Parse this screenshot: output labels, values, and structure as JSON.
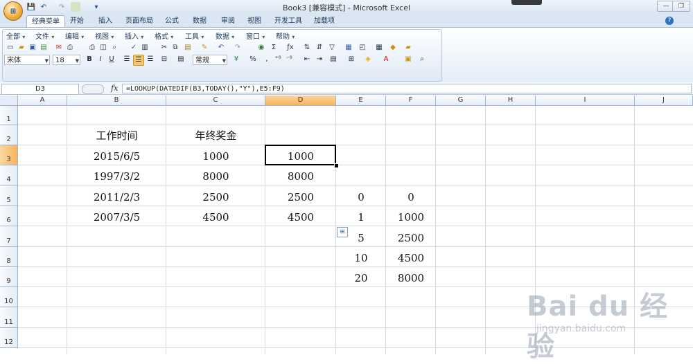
{
  "window": {
    "title": "Book3  [兼容模式] - Microsoft Excel",
    "office_button": "⊞",
    "controls": [
      "—",
      "❐",
      "✕"
    ]
  },
  "quick_access": [
    "💾",
    "↶",
    "↷",
    "▾"
  ],
  "ribbon": {
    "tabs": [
      "经典菜单",
      "开始",
      "插入",
      "页面布局",
      "公式",
      "数据",
      "审阅",
      "视图",
      "开发工具",
      "加载项"
    ],
    "active_tab": "经典菜单",
    "menus": [
      "全部",
      "文件",
      "编辑",
      "视图",
      "插入",
      "格式",
      "工具",
      "数据",
      "窗口",
      "帮助"
    ],
    "font_name": "宋体",
    "font_size": "18",
    "number_format": "常规",
    "currency_symbol": "¥",
    "percent_symbol": "%",
    "comma_symbol": ","
  },
  "formula_bar": {
    "name_box": "D3",
    "fx": "fx",
    "formula": "=LOOKUP(DATEDIF(B3,TODAY(),\"Y\"),E5:F9)"
  },
  "columns": [
    "A",
    "B",
    "C",
    "D",
    "E",
    "F",
    "G",
    "H",
    "I",
    "J"
  ],
  "selected_column": "D",
  "rows": [
    "1",
    "2",
    "3",
    "4",
    "5",
    "6",
    "7",
    "8",
    "9",
    "10",
    "11",
    "12"
  ],
  "selected_row": "3",
  "cells": {
    "B2": "工作时间",
    "C2": "年终奖金",
    "B3": "2015/6/5",
    "C3": "1000",
    "D3": "1000",
    "B4": "1997/3/2",
    "C4": "8000",
    "D4": "8000",
    "B5": "2011/2/3",
    "C5": "2500",
    "D5": "2500",
    "E5": "0",
    "F5": "0",
    "B6": "2007/3/5",
    "C6": "4500",
    "D6": "4500",
    "E6": "1",
    "F6": "1000",
    "E7": "5",
    "F7": "2500",
    "E8": "10",
    "F8": "4500",
    "E9": "20",
    "F9": "8000"
  },
  "watermark": {
    "logo": "Bai du 经验",
    "url": "jingyan.baidu.com"
  }
}
